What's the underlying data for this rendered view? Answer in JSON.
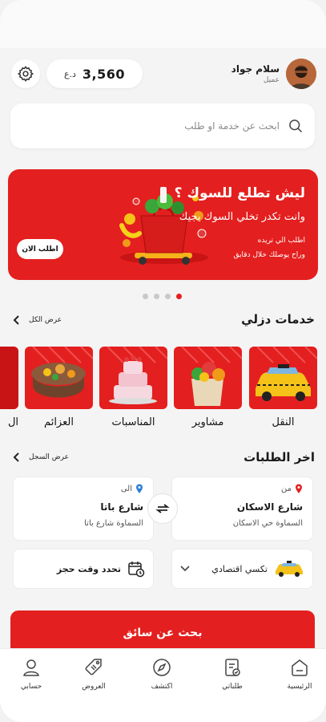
{
  "header": {
    "balance_amount": "3,560",
    "balance_currency": "د.ع",
    "user_name": "سلام جواد",
    "user_role": "عميل"
  },
  "search": {
    "placeholder": "ابحث عن خدمة او طلب"
  },
  "banner": {
    "title": "ليش تطلع للسوك ؟",
    "subtitle": "وانت تكدر تخلي السوك يجيك",
    "line1": "اطلب الي تريده",
    "line2": "وراح يوصلك خلال دقايق",
    "button": "اطلب الان",
    "dots": 4,
    "active_dot": 4
  },
  "services": {
    "title": "خدمات دزلي",
    "view_all": "عرض الكل",
    "items": [
      {
        "label": "النقل",
        "icon": "taxi-icon"
      },
      {
        "label": "مشاوير",
        "icon": "grocery-bag-icon"
      },
      {
        "label": "المناسبات",
        "icon": "cake-icon"
      },
      {
        "label": "العزائم",
        "icon": "feast-table-icon"
      },
      {
        "label": "ال",
        "icon": "partial-icon"
      }
    ]
  },
  "orders": {
    "title": "اخر الطلبات",
    "view_history": "عرض السجل",
    "from_label": "من",
    "from_street": "شارع الاسكان",
    "from_area": "السماوة حي الاسكان",
    "to_label": "الى",
    "to_street": "شارع باتا",
    "to_area": "السماوة شارع باتا",
    "vehicle": "تكسي اقتصادي",
    "time": "تحدد وقت حجز",
    "search_button": "بحث عن سائق"
  },
  "nav": {
    "items": [
      {
        "label": "الرئيسية",
        "icon": "home-icon"
      },
      {
        "label": "طلباتي",
        "icon": "orders-icon"
      },
      {
        "label": "اكتشف",
        "icon": "compass-icon"
      },
      {
        "label": "العروض",
        "icon": "tag-icon"
      },
      {
        "label": "حسابي",
        "icon": "user-icon"
      }
    ]
  },
  "colors": {
    "accent": "#e41f1f",
    "background": "#f4f4f4",
    "card": "#ffffff"
  }
}
